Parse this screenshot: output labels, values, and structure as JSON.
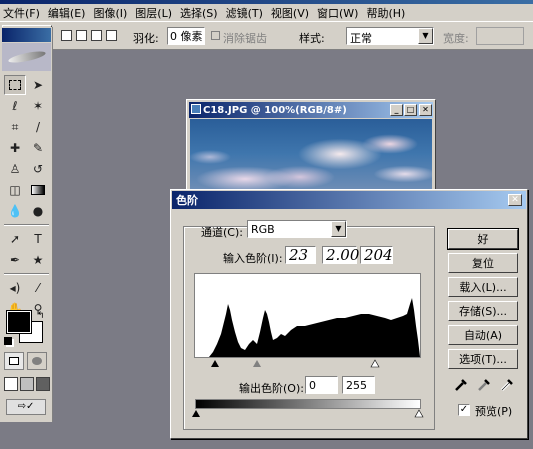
{
  "menu": [
    "文件(F)",
    "编辑(E)",
    "图像(I)",
    "图层(L)",
    "选择(S)",
    "滤镜(T)",
    "视图(V)",
    "窗口(W)",
    "帮助(H)"
  ],
  "options_bar": {
    "feather_label": "羽化:",
    "feather_value": "0 像素",
    "antialias_label": "消除锯齿",
    "style_label": "样式:",
    "style_value": "正常",
    "width_label": "宽度:"
  },
  "image_window": {
    "title": "C18.JPG @ 100%(RGB/8#)"
  },
  "levels_dialog": {
    "title": "色阶",
    "channel_label": "通道(C):",
    "channel_value": "RGB",
    "input_label": "输入色阶(I):",
    "input_black": "23",
    "input_gamma": "2.00",
    "input_white": "204",
    "output_label": "输出色阶(O):",
    "output_black": "0",
    "output_white": "255",
    "buttons": {
      "ok": "好",
      "reset": "复位",
      "load": "载入(L)...",
      "save": "存储(S)...",
      "auto": "自动(A)",
      "options": "选项(T)..."
    },
    "preview_label": "预览(P)",
    "preview_checked": true
  },
  "colors": {
    "foreground": "#000000",
    "background": "#ffffff",
    "titlebar": "#0a246a",
    "workspace": "#7b7b85"
  }
}
